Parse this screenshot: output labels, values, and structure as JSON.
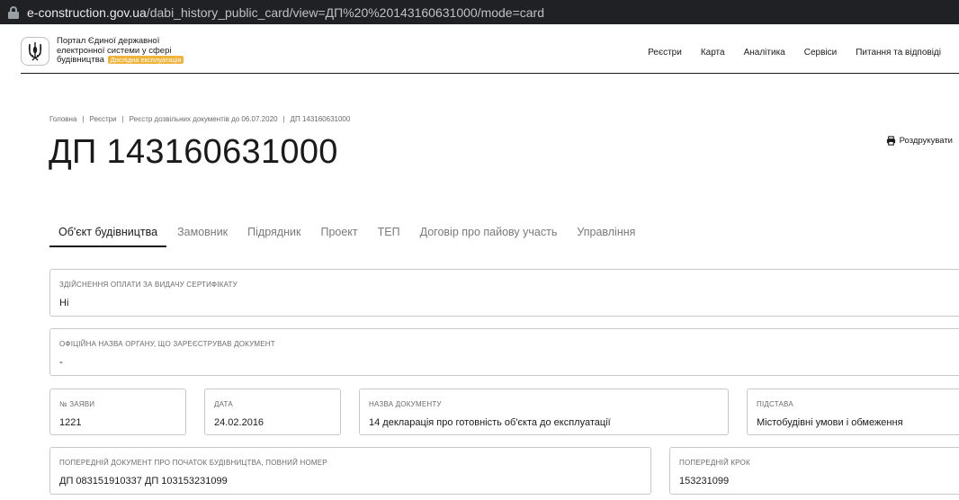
{
  "browser": {
    "url_host": "e-construction.gov.ua",
    "url_path": "/dabi_history_public_card/view=ДП%20%20143160631000/mode=card"
  },
  "header": {
    "brand_line1": "Портал Єдиної державної",
    "brand_line2": "електронної системи у сфері",
    "brand_line3": "будівництва",
    "brand_badge": "Дослідна експлуатація",
    "nav": [
      "Реєстри",
      "Карта",
      "Аналітика",
      "Сервіси",
      "Питання та відповіді"
    ]
  },
  "breadcrumb": [
    "Головна",
    "Реєстри",
    "Реєстр дозвільних документів до 06.07.2020",
    "ДП 143160631000"
  ],
  "page": {
    "title": "ДП 143160631000",
    "print_label": "Роздрукувати"
  },
  "tabs": [
    "Об'єкт будівництва",
    "Замовник",
    "Підрядник",
    "Проект",
    "ТЕП",
    "Договір про пайову участь",
    "Управління"
  ],
  "fields": {
    "payment": {
      "label": "ЗДІЙСНЕННЯ ОПЛАТИ ЗА ВИДАЧУ СЕРТИФІКАТУ",
      "value": "Ні"
    },
    "authority": {
      "label": "ОФІЦІЙНА НАЗВА ОРГАНУ, ЩО ЗАРЕЄСТРУВАВ ДОКУМЕНТ",
      "value": "-"
    },
    "application_no": {
      "label": "№ ЗАЯВИ",
      "value": "1221"
    },
    "date": {
      "label": "ДАТА",
      "value": "24.02.2016"
    },
    "doc_name": {
      "label": "НАЗВА ДОКУМЕНТУ",
      "value": "14 декларація про готовність об'єкта до експлуатації"
    },
    "basis": {
      "label": "ПІДСТАВА",
      "value": "Містобудівні умови і обмеження"
    },
    "prev_doc": {
      "label": "ПОПЕРЕДНІЙ ДОКУМЕНТ ПРО ПОЧАТОК БУДІВНИЦТВА, ПОВНИЙ НОМЕР",
      "value": "ДП 083151910337 ДП 103153231099"
    },
    "prev_step": {
      "label": "ПОПЕРЕДНІЙ КРОК",
      "value": "153231099"
    }
  }
}
